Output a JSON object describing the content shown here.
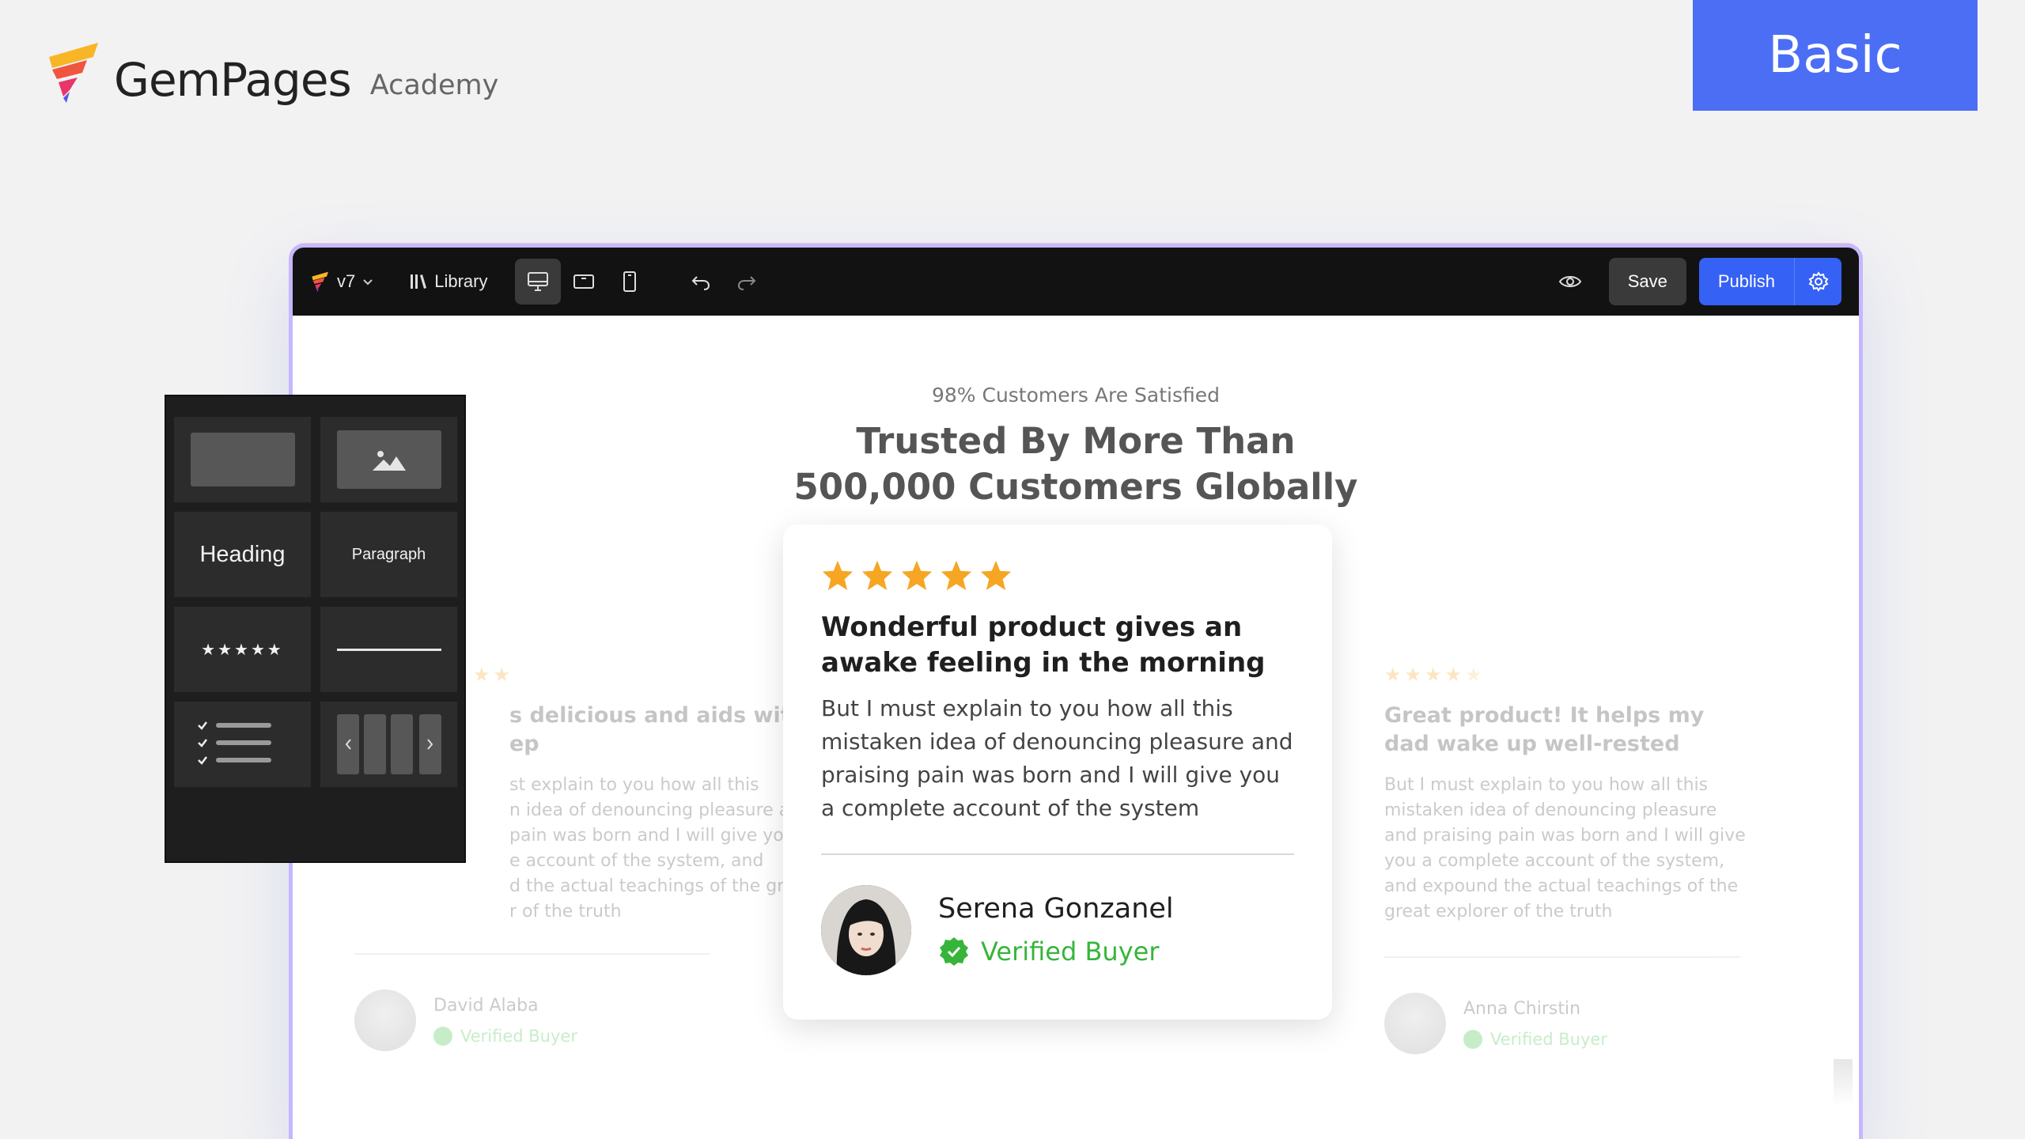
{
  "brand": {
    "name": "GemPages",
    "sub": "Academy"
  },
  "tier_badge": "Basic",
  "colors": {
    "accent": "#3561f5",
    "badge": "#4b6ef5",
    "star": "#f6a623",
    "verified": "#37b53a"
  },
  "toolbar": {
    "version": "v7",
    "library": "Library",
    "devices": [
      "desktop-icon",
      "tablet-icon",
      "mobile-icon"
    ],
    "active_device": "desktop",
    "save": "Save",
    "publish": "Publish"
  },
  "section": {
    "subheading": "98% Customers Are Satisfied",
    "heading_line1": "Trusted By More Than",
    "heading_line2": "500,000 Customers Globally"
  },
  "reviews": {
    "left": {
      "rating": 5,
      "title_line1": "s delicious and aids with",
      "title_line2": "ep",
      "body_lines": [
        "st explain to you how all this",
        "n idea of denouncing pleasure and",
        "pain was born and I will give you a",
        "e account of the system, and",
        "d the actual teachings of the great",
        "r of the truth"
      ],
      "name": "David Alaba",
      "verified": "Verified Buyer"
    },
    "center": {
      "rating": 5,
      "title": "Wonderful product gives an awake feeling in the morning",
      "body": "But I must explain to you how all this mistaken idea of denouncing pleasure and praising pain was born and I will give you a complete account of the system",
      "name": "Serena Gonzanel",
      "verified": "Verified Buyer"
    },
    "right": {
      "rating": 4.5,
      "title": "Great product! It helps my dad wake up well-rested",
      "body": "But I must explain to you how all this mistaken idea of denouncing pleasure and praising pain was born and I will give you a complete account of the system, and expound the actual teachings of the great explorer of the truth",
      "name": "Anna Chirstin",
      "verified": "Verified Buyer"
    }
  },
  "palette": {
    "heading": "Heading",
    "paragraph": "Paragraph",
    "stars": "★★★★★"
  }
}
